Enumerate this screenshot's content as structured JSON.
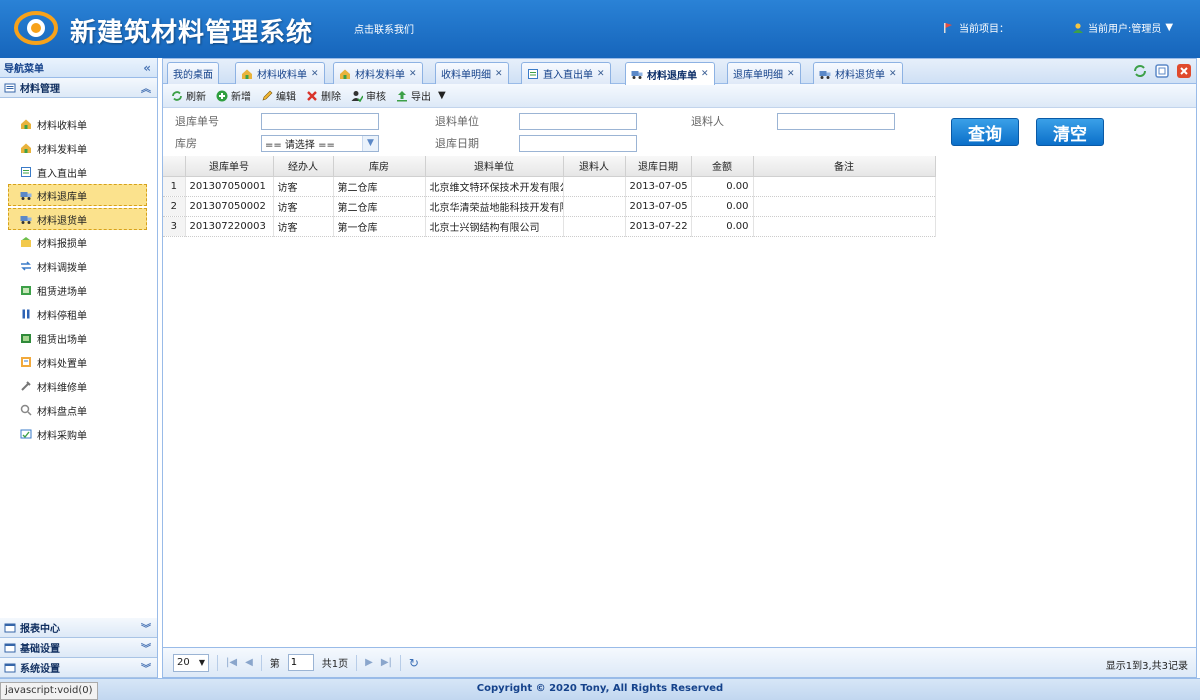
{
  "header": {
    "title": "新建筑材料管理系统",
    "contact": "点击联系我们",
    "project_label": "当前项目：",
    "user_label": "当前用户:管理员"
  },
  "sidebar": {
    "nav_title": "导航菜单",
    "section_title": "材料管理",
    "items": [
      {
        "label": "材料收料单",
        "icon": "house-icon"
      },
      {
        "label": "材料发料单",
        "icon": "house-icon"
      },
      {
        "label": "直入直出单",
        "icon": "doc-icon"
      },
      {
        "label": "材料退库单",
        "icon": "truck-icon"
      },
      {
        "label": "材料退货单",
        "icon": "truck-icon"
      },
      {
        "label": "材料报损单",
        "icon": "damage-icon"
      },
      {
        "label": "材料调拨单",
        "icon": "transfer-icon"
      },
      {
        "label": "租赁进场单",
        "icon": "lease-in-icon"
      },
      {
        "label": "材料停租单",
        "icon": "pause-icon"
      },
      {
        "label": "租赁出场单",
        "icon": "lease-out-icon"
      },
      {
        "label": "材料处置单",
        "icon": "dispose-icon"
      },
      {
        "label": "材料维修单",
        "icon": "wrench-icon"
      },
      {
        "label": "材料盘点单",
        "icon": "inventory-icon"
      },
      {
        "label": "材料采购单",
        "icon": "purchase-icon"
      }
    ],
    "bottom_sections": [
      "报表中心",
      "基础设置",
      "系统设置"
    ]
  },
  "tabs": [
    {
      "label": "我的桌面",
      "closable": false
    },
    {
      "label": "材料收料单",
      "closable": true
    },
    {
      "label": "材料发料单",
      "closable": true
    },
    {
      "label": "收料单明细",
      "closable": true
    },
    {
      "label": "直入直出单",
      "closable": true
    },
    {
      "label": "材料退库单",
      "closable": true,
      "active": true
    },
    {
      "label": "退库单明细",
      "closable": true
    },
    {
      "label": "材料退货单",
      "closable": true
    }
  ],
  "toolbar": {
    "refresh": "刷新",
    "add": "新增",
    "edit": "编辑",
    "delete": "删除",
    "audit": "审核",
    "export": "导出"
  },
  "search": {
    "return_no_label": "退库单号",
    "return_unit_label": "退料单位",
    "returner_label": "退料人",
    "warehouse_label": "库房",
    "warehouse_value": "== 请选择 ==",
    "date_label": "退库日期",
    "query_button": "查询",
    "clear_button": "清空"
  },
  "grid": {
    "columns": [
      "退库单号",
      "经办人",
      "库房",
      "退料单位",
      "退料人",
      "退库日期",
      "金额",
      "备注"
    ],
    "rows": [
      {
        "rn": "1",
        "no": "201307050001",
        "handler": "访客",
        "warehouse": "第二仓库",
        "unit": "北京维文特环保技术开发有限公司",
        "returner": "",
        "date": "2013-07-05",
        "amount": "0.00",
        "remark": ""
      },
      {
        "rn": "2",
        "no": "201307050002",
        "handler": "访客",
        "warehouse": "第二仓库",
        "unit": "北京华清荣益地能科技开发有限公司",
        "returner": "",
        "date": "2013-07-05",
        "amount": "0.00",
        "remark": ""
      },
      {
        "rn": "3",
        "no": "201307220003",
        "handler": "访客",
        "warehouse": "第一仓库",
        "unit": "北京士兴钢结构有限公司",
        "returner": "",
        "date": "2013-07-22",
        "amount": "0.00",
        "remark": ""
      }
    ]
  },
  "pager": {
    "page_size": "20",
    "page_prefix": "第",
    "page_value": "1",
    "page_total": "共1页",
    "info": "显示1到3,共3记录"
  },
  "footer": {
    "status_url": "javascript:void(0)",
    "copyright": "Copyright © 2020 Tony, All Rights Reserved"
  }
}
